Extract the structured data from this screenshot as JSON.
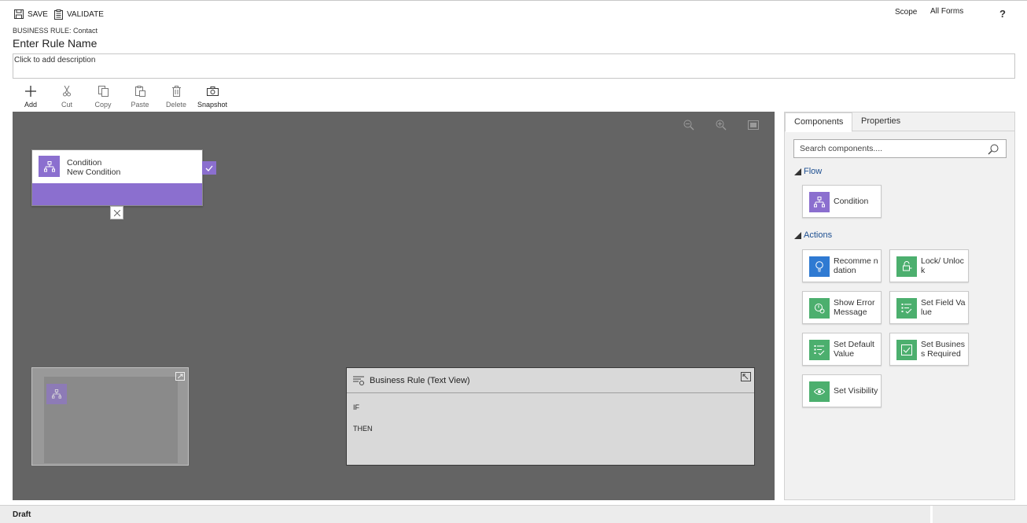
{
  "header": {
    "save_label": "SAVE",
    "validate_label": "VALIDATE",
    "scope_label": "Scope",
    "scope_value": "All Forms",
    "help_label": "?"
  },
  "rule": {
    "entity_label": "BUSINESS RULE: Contact",
    "name": "Enter Rule Name",
    "description_placeholder": "Click to add description"
  },
  "toolbar": {
    "add": "Add",
    "cut": "Cut",
    "copy": "Copy",
    "paste": "Paste",
    "delete": "Delete",
    "snapshot": "Snapshot"
  },
  "canvas": {
    "node": {
      "type": "Condition",
      "name": "New Condition"
    },
    "text_view": {
      "title": "Business Rule (Text View)",
      "if_label": "IF",
      "then_label": "THEN"
    }
  },
  "panel": {
    "tabs": [
      "Components",
      "Properties"
    ],
    "search_placeholder": "Search components....",
    "flow_label": "Flow",
    "actions_label": "Actions",
    "flow_items": [
      {
        "label": "Condition",
        "color": "#8b6fcf"
      }
    ],
    "action_items": [
      {
        "label": "Recomme ndation",
        "color": "#2f7ad2"
      },
      {
        "label": "Lock/ Unlock",
        "color": "#4caf6e"
      },
      {
        "label": "Show Error Message",
        "color": "#4caf6e"
      },
      {
        "label": "Set Field Value",
        "color": "#4caf6e"
      },
      {
        "label": "Set Default Value",
        "color": "#4caf6e"
      },
      {
        "label": "Set Business Required",
        "color": "#4caf6e"
      },
      {
        "label": "Set Visibility",
        "color": "#4caf6e"
      }
    ]
  },
  "status": {
    "state": "Draft"
  },
  "colors": {
    "condition": "#8b6fcf",
    "action": "#4caf6e",
    "recommendation": "#2f7ad2",
    "canvas": "#646464"
  }
}
